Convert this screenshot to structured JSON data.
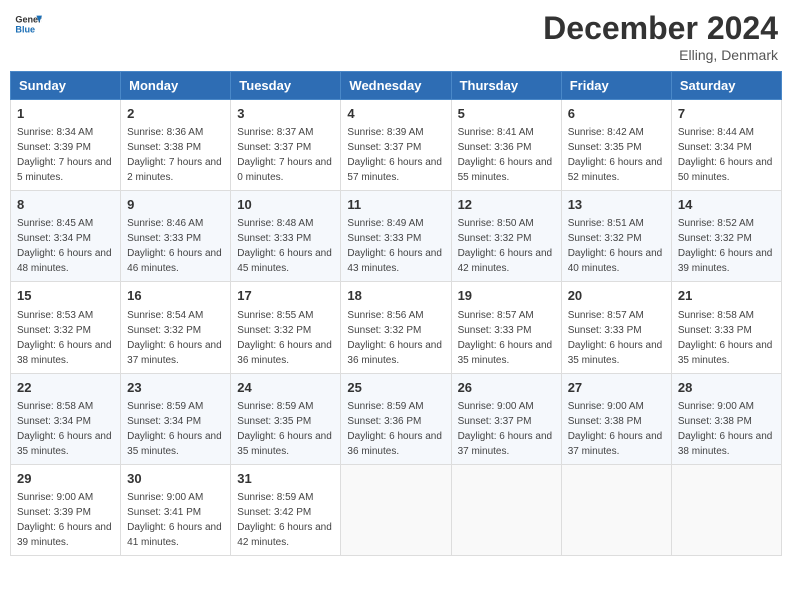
{
  "logo": {
    "line1": "General",
    "line2": "Blue"
  },
  "title": "December 2024",
  "location": "Elling, Denmark",
  "days_of_week": [
    "Sunday",
    "Monday",
    "Tuesday",
    "Wednesday",
    "Thursday",
    "Friday",
    "Saturday"
  ],
  "weeks": [
    [
      {
        "day": "1",
        "sunrise": "Sunrise: 8:34 AM",
        "sunset": "Sunset: 3:39 PM",
        "daylight": "Daylight: 7 hours and 5 minutes."
      },
      {
        "day": "2",
        "sunrise": "Sunrise: 8:36 AM",
        "sunset": "Sunset: 3:38 PM",
        "daylight": "Daylight: 7 hours and 2 minutes."
      },
      {
        "day": "3",
        "sunrise": "Sunrise: 8:37 AM",
        "sunset": "Sunset: 3:37 PM",
        "daylight": "Daylight: 7 hours and 0 minutes."
      },
      {
        "day": "4",
        "sunrise": "Sunrise: 8:39 AM",
        "sunset": "Sunset: 3:37 PM",
        "daylight": "Daylight: 6 hours and 57 minutes."
      },
      {
        "day": "5",
        "sunrise": "Sunrise: 8:41 AM",
        "sunset": "Sunset: 3:36 PM",
        "daylight": "Daylight: 6 hours and 55 minutes."
      },
      {
        "day": "6",
        "sunrise": "Sunrise: 8:42 AM",
        "sunset": "Sunset: 3:35 PM",
        "daylight": "Daylight: 6 hours and 52 minutes."
      },
      {
        "day": "7",
        "sunrise": "Sunrise: 8:44 AM",
        "sunset": "Sunset: 3:34 PM",
        "daylight": "Daylight: 6 hours and 50 minutes."
      }
    ],
    [
      {
        "day": "8",
        "sunrise": "Sunrise: 8:45 AM",
        "sunset": "Sunset: 3:34 PM",
        "daylight": "Daylight: 6 hours and 48 minutes."
      },
      {
        "day": "9",
        "sunrise": "Sunrise: 8:46 AM",
        "sunset": "Sunset: 3:33 PM",
        "daylight": "Daylight: 6 hours and 46 minutes."
      },
      {
        "day": "10",
        "sunrise": "Sunrise: 8:48 AM",
        "sunset": "Sunset: 3:33 PM",
        "daylight": "Daylight: 6 hours and 45 minutes."
      },
      {
        "day": "11",
        "sunrise": "Sunrise: 8:49 AM",
        "sunset": "Sunset: 3:33 PM",
        "daylight": "Daylight: 6 hours and 43 minutes."
      },
      {
        "day": "12",
        "sunrise": "Sunrise: 8:50 AM",
        "sunset": "Sunset: 3:32 PM",
        "daylight": "Daylight: 6 hours and 42 minutes."
      },
      {
        "day": "13",
        "sunrise": "Sunrise: 8:51 AM",
        "sunset": "Sunset: 3:32 PM",
        "daylight": "Daylight: 6 hours and 40 minutes."
      },
      {
        "day": "14",
        "sunrise": "Sunrise: 8:52 AM",
        "sunset": "Sunset: 3:32 PM",
        "daylight": "Daylight: 6 hours and 39 minutes."
      }
    ],
    [
      {
        "day": "15",
        "sunrise": "Sunrise: 8:53 AM",
        "sunset": "Sunset: 3:32 PM",
        "daylight": "Daylight: 6 hours and 38 minutes."
      },
      {
        "day": "16",
        "sunrise": "Sunrise: 8:54 AM",
        "sunset": "Sunset: 3:32 PM",
        "daylight": "Daylight: 6 hours and 37 minutes."
      },
      {
        "day": "17",
        "sunrise": "Sunrise: 8:55 AM",
        "sunset": "Sunset: 3:32 PM",
        "daylight": "Daylight: 6 hours and 36 minutes."
      },
      {
        "day": "18",
        "sunrise": "Sunrise: 8:56 AM",
        "sunset": "Sunset: 3:32 PM",
        "daylight": "Daylight: 6 hours and 36 minutes."
      },
      {
        "day": "19",
        "sunrise": "Sunrise: 8:57 AM",
        "sunset": "Sunset: 3:33 PM",
        "daylight": "Daylight: 6 hours and 35 minutes."
      },
      {
        "day": "20",
        "sunrise": "Sunrise: 8:57 AM",
        "sunset": "Sunset: 3:33 PM",
        "daylight": "Daylight: 6 hours and 35 minutes."
      },
      {
        "day": "21",
        "sunrise": "Sunrise: 8:58 AM",
        "sunset": "Sunset: 3:33 PM",
        "daylight": "Daylight: 6 hours and 35 minutes."
      }
    ],
    [
      {
        "day": "22",
        "sunrise": "Sunrise: 8:58 AM",
        "sunset": "Sunset: 3:34 PM",
        "daylight": "Daylight: 6 hours and 35 minutes."
      },
      {
        "day": "23",
        "sunrise": "Sunrise: 8:59 AM",
        "sunset": "Sunset: 3:34 PM",
        "daylight": "Daylight: 6 hours and 35 minutes."
      },
      {
        "day": "24",
        "sunrise": "Sunrise: 8:59 AM",
        "sunset": "Sunset: 3:35 PM",
        "daylight": "Daylight: 6 hours and 35 minutes."
      },
      {
        "day": "25",
        "sunrise": "Sunrise: 8:59 AM",
        "sunset": "Sunset: 3:36 PM",
        "daylight": "Daylight: 6 hours and 36 minutes."
      },
      {
        "day": "26",
        "sunrise": "Sunrise: 9:00 AM",
        "sunset": "Sunset: 3:37 PM",
        "daylight": "Daylight: 6 hours and 37 minutes."
      },
      {
        "day": "27",
        "sunrise": "Sunrise: 9:00 AM",
        "sunset": "Sunset: 3:38 PM",
        "daylight": "Daylight: 6 hours and 37 minutes."
      },
      {
        "day": "28",
        "sunrise": "Sunrise: 9:00 AM",
        "sunset": "Sunset: 3:38 PM",
        "daylight": "Daylight: 6 hours and 38 minutes."
      }
    ],
    [
      {
        "day": "29",
        "sunrise": "Sunrise: 9:00 AM",
        "sunset": "Sunset: 3:39 PM",
        "daylight": "Daylight: 6 hours and 39 minutes."
      },
      {
        "day": "30",
        "sunrise": "Sunrise: 9:00 AM",
        "sunset": "Sunset: 3:41 PM",
        "daylight": "Daylight: 6 hours and 41 minutes."
      },
      {
        "day": "31",
        "sunrise": "Sunrise: 8:59 AM",
        "sunset": "Sunset: 3:42 PM",
        "daylight": "Daylight: 6 hours and 42 minutes."
      },
      null,
      null,
      null,
      null
    ]
  ]
}
